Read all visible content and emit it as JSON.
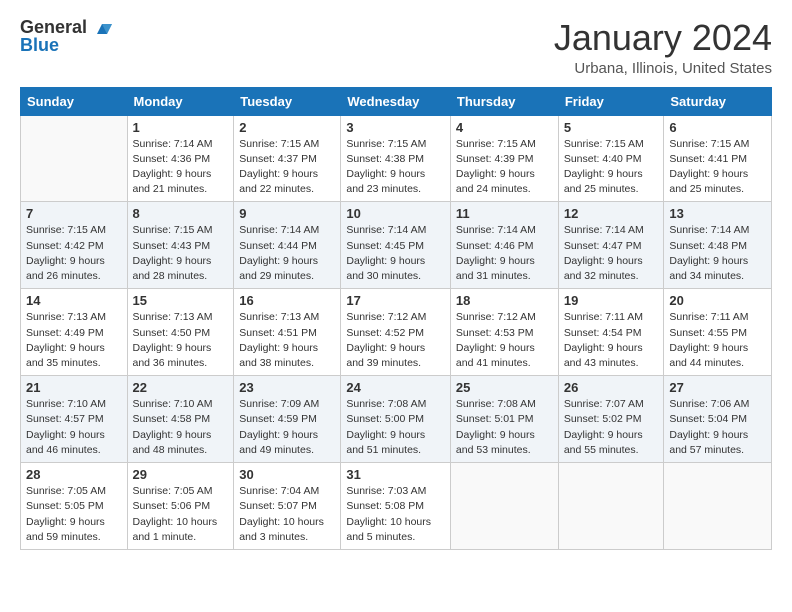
{
  "header": {
    "logo_text_general": "General",
    "logo_text_blue": "Blue",
    "title": "January 2024",
    "subtitle": "Urbana, Illinois, United States"
  },
  "weekdays": [
    "Sunday",
    "Monday",
    "Tuesday",
    "Wednesday",
    "Thursday",
    "Friday",
    "Saturday"
  ],
  "weeks": [
    [
      {
        "day": "",
        "sunrise": "",
        "sunset": "",
        "daylight": ""
      },
      {
        "day": "1",
        "sunrise": "Sunrise: 7:14 AM",
        "sunset": "Sunset: 4:36 PM",
        "daylight": "Daylight: 9 hours and 21 minutes."
      },
      {
        "day": "2",
        "sunrise": "Sunrise: 7:15 AM",
        "sunset": "Sunset: 4:37 PM",
        "daylight": "Daylight: 9 hours and 22 minutes."
      },
      {
        "day": "3",
        "sunrise": "Sunrise: 7:15 AM",
        "sunset": "Sunset: 4:38 PM",
        "daylight": "Daylight: 9 hours and 23 minutes."
      },
      {
        "day": "4",
        "sunrise": "Sunrise: 7:15 AM",
        "sunset": "Sunset: 4:39 PM",
        "daylight": "Daylight: 9 hours and 24 minutes."
      },
      {
        "day": "5",
        "sunrise": "Sunrise: 7:15 AM",
        "sunset": "Sunset: 4:40 PM",
        "daylight": "Daylight: 9 hours and 25 minutes."
      },
      {
        "day": "6",
        "sunrise": "Sunrise: 7:15 AM",
        "sunset": "Sunset: 4:41 PM",
        "daylight": "Daylight: 9 hours and 25 minutes."
      }
    ],
    [
      {
        "day": "7",
        "sunrise": "Sunrise: 7:15 AM",
        "sunset": "Sunset: 4:42 PM",
        "daylight": "Daylight: 9 hours and 26 minutes."
      },
      {
        "day": "8",
        "sunrise": "Sunrise: 7:15 AM",
        "sunset": "Sunset: 4:43 PM",
        "daylight": "Daylight: 9 hours and 28 minutes."
      },
      {
        "day": "9",
        "sunrise": "Sunrise: 7:14 AM",
        "sunset": "Sunset: 4:44 PM",
        "daylight": "Daylight: 9 hours and 29 minutes."
      },
      {
        "day": "10",
        "sunrise": "Sunrise: 7:14 AM",
        "sunset": "Sunset: 4:45 PM",
        "daylight": "Daylight: 9 hours and 30 minutes."
      },
      {
        "day": "11",
        "sunrise": "Sunrise: 7:14 AM",
        "sunset": "Sunset: 4:46 PM",
        "daylight": "Daylight: 9 hours and 31 minutes."
      },
      {
        "day": "12",
        "sunrise": "Sunrise: 7:14 AM",
        "sunset": "Sunset: 4:47 PM",
        "daylight": "Daylight: 9 hours and 32 minutes."
      },
      {
        "day": "13",
        "sunrise": "Sunrise: 7:14 AM",
        "sunset": "Sunset: 4:48 PM",
        "daylight": "Daylight: 9 hours and 34 minutes."
      }
    ],
    [
      {
        "day": "14",
        "sunrise": "Sunrise: 7:13 AM",
        "sunset": "Sunset: 4:49 PM",
        "daylight": "Daylight: 9 hours and 35 minutes."
      },
      {
        "day": "15",
        "sunrise": "Sunrise: 7:13 AM",
        "sunset": "Sunset: 4:50 PM",
        "daylight": "Daylight: 9 hours and 36 minutes."
      },
      {
        "day": "16",
        "sunrise": "Sunrise: 7:13 AM",
        "sunset": "Sunset: 4:51 PM",
        "daylight": "Daylight: 9 hours and 38 minutes."
      },
      {
        "day": "17",
        "sunrise": "Sunrise: 7:12 AM",
        "sunset": "Sunset: 4:52 PM",
        "daylight": "Daylight: 9 hours and 39 minutes."
      },
      {
        "day": "18",
        "sunrise": "Sunrise: 7:12 AM",
        "sunset": "Sunset: 4:53 PM",
        "daylight": "Daylight: 9 hours and 41 minutes."
      },
      {
        "day": "19",
        "sunrise": "Sunrise: 7:11 AM",
        "sunset": "Sunset: 4:54 PM",
        "daylight": "Daylight: 9 hours and 43 minutes."
      },
      {
        "day": "20",
        "sunrise": "Sunrise: 7:11 AM",
        "sunset": "Sunset: 4:55 PM",
        "daylight": "Daylight: 9 hours and 44 minutes."
      }
    ],
    [
      {
        "day": "21",
        "sunrise": "Sunrise: 7:10 AM",
        "sunset": "Sunset: 4:57 PM",
        "daylight": "Daylight: 9 hours and 46 minutes."
      },
      {
        "day": "22",
        "sunrise": "Sunrise: 7:10 AM",
        "sunset": "Sunset: 4:58 PM",
        "daylight": "Daylight: 9 hours and 48 minutes."
      },
      {
        "day": "23",
        "sunrise": "Sunrise: 7:09 AM",
        "sunset": "Sunset: 4:59 PM",
        "daylight": "Daylight: 9 hours and 49 minutes."
      },
      {
        "day": "24",
        "sunrise": "Sunrise: 7:08 AM",
        "sunset": "Sunset: 5:00 PM",
        "daylight": "Daylight: 9 hours and 51 minutes."
      },
      {
        "day": "25",
        "sunrise": "Sunrise: 7:08 AM",
        "sunset": "Sunset: 5:01 PM",
        "daylight": "Daylight: 9 hours and 53 minutes."
      },
      {
        "day": "26",
        "sunrise": "Sunrise: 7:07 AM",
        "sunset": "Sunset: 5:02 PM",
        "daylight": "Daylight: 9 hours and 55 minutes."
      },
      {
        "day": "27",
        "sunrise": "Sunrise: 7:06 AM",
        "sunset": "Sunset: 5:04 PM",
        "daylight": "Daylight: 9 hours and 57 minutes."
      }
    ],
    [
      {
        "day": "28",
        "sunrise": "Sunrise: 7:05 AM",
        "sunset": "Sunset: 5:05 PM",
        "daylight": "Daylight: 9 hours and 59 minutes."
      },
      {
        "day": "29",
        "sunrise": "Sunrise: 7:05 AM",
        "sunset": "Sunset: 5:06 PM",
        "daylight": "Daylight: 10 hours and 1 minute."
      },
      {
        "day": "30",
        "sunrise": "Sunrise: 7:04 AM",
        "sunset": "Sunset: 5:07 PM",
        "daylight": "Daylight: 10 hours and 3 minutes."
      },
      {
        "day": "31",
        "sunrise": "Sunrise: 7:03 AM",
        "sunset": "Sunset: 5:08 PM",
        "daylight": "Daylight: 10 hours and 5 minutes."
      },
      {
        "day": "",
        "sunrise": "",
        "sunset": "",
        "daylight": ""
      },
      {
        "day": "",
        "sunrise": "",
        "sunset": "",
        "daylight": ""
      },
      {
        "day": "",
        "sunrise": "",
        "sunset": "",
        "daylight": ""
      }
    ]
  ]
}
